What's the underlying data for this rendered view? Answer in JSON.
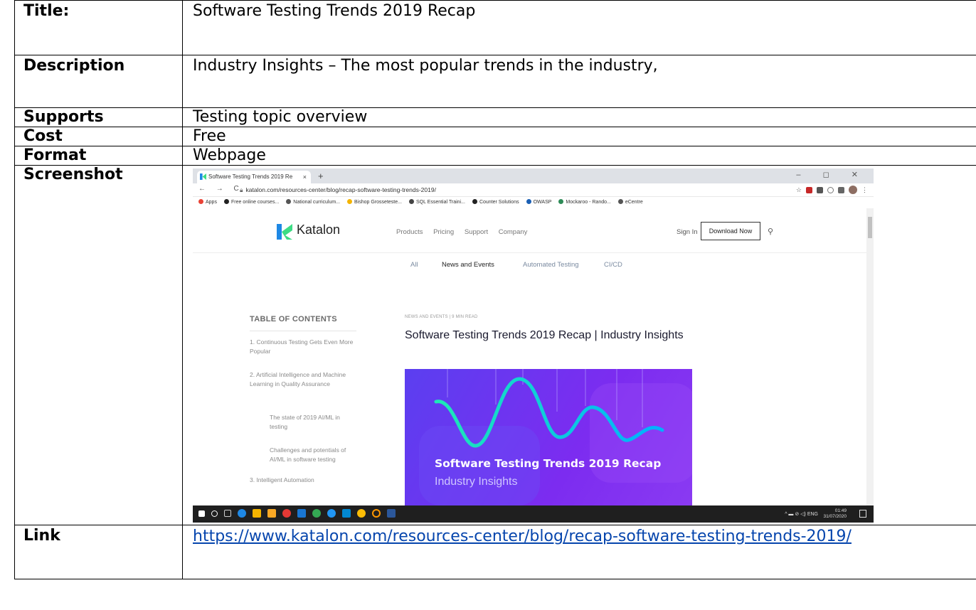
{
  "doc": {
    "title_label": "Title:",
    "title_value": "Software Testing Trends 2019 Recap",
    "description_label": "Description",
    "description_value": "Industry Insights – The most popular trends in the industry,",
    "supports_label": "Supports",
    "supports_value": "Testing topic overview",
    "cost_label": "Cost",
    "cost_value": "Free",
    "format_label": "Format",
    "format_value": "Webpage",
    "screenshot_label": "Screenshot",
    "link_label": "Link",
    "link_value": "https://www.katalon.com/resources-center/blog/recap-software-testing-trends-2019/"
  },
  "browser": {
    "tab_title": "Software Testing Trends 2019 Re",
    "tab_close": "×",
    "new_tab": "+",
    "window_controls": "– ◻ ✕",
    "nav_buttons": "← → C",
    "url": "katalon.com/resources-center/blog/recap-software-testing-trends-2019/",
    "bookmarks": [
      {
        "label": "Apps",
        "color": "#e94235"
      },
      {
        "label": "Free online courses...",
        "color": "#222222"
      },
      {
        "label": "National curriculum...",
        "color": "#555555"
      },
      {
        "label": "Bishop Grosseteste...",
        "color": "#f4b400"
      },
      {
        "label": "SQL Essential Traini...",
        "color": "#444444"
      },
      {
        "label": "Counter Solutions",
        "color": "#222222"
      },
      {
        "label": "OWASP",
        "color": "#1a5fb4"
      },
      {
        "label": "Mockaroo - Rando...",
        "color": "#2e8b57"
      },
      {
        "label": "eCentre",
        "color": "#555555"
      }
    ]
  },
  "site": {
    "brand": "Katalon",
    "menu": [
      "Products",
      "Pricing",
      "Support",
      "Company"
    ],
    "sign_in": "Sign In",
    "download": "Download Now",
    "categories": [
      "All",
      "News and Events",
      "Automated Testing",
      "CI/CD"
    ],
    "active_category": "News and Events",
    "toc_heading": "TABLE OF CONTENTS",
    "toc_items": [
      "1. Continuous Testing Gets Even More Popular",
      "2. Artificial Intelligence and Machine Learning in Quality Assurance",
      "The state of 2019 AI/ML in testing",
      "Challenges and potentials of AI/ML in software testing",
      "3. Intelligent Automation"
    ],
    "crumb": "NEWS AND EVENTS | 9 MIN READ",
    "article_title": "Software Testing Trends 2019 Recap | Industry Insights",
    "hero_title": "Software Testing Trends 2019 Recap",
    "hero_subtitle": "Industry Insights"
  },
  "taskbar": {
    "tray_lang": "^ ▬ ⊘ ◁) ENG",
    "time": "01:49",
    "date": "31/07/2020"
  },
  "colors": {
    "link": "#0645ad",
    "hero_start": "#5b3ff0",
    "hero_end": "#8a3af2",
    "wave_start": "#1de9b6",
    "wave_end": "#00b0ff",
    "katalon_green": "#3ddc84",
    "katalon_blue": "#1e88e5"
  }
}
